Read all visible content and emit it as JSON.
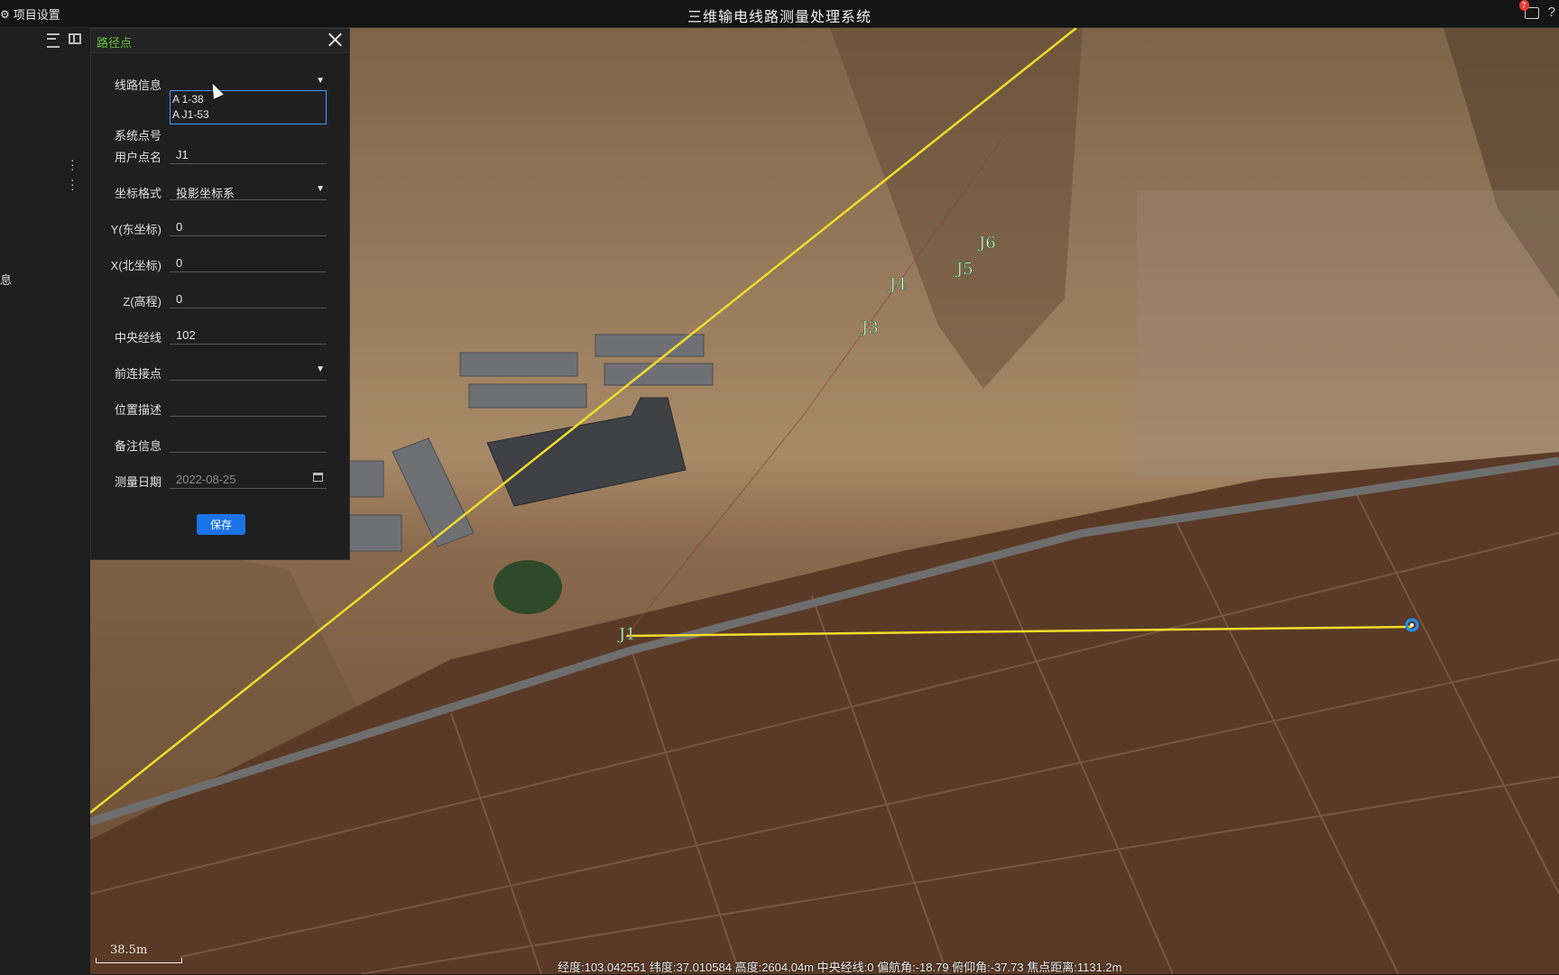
{
  "titlebar": {
    "project_settings": "项目设置",
    "app_title": "三维输电线路测量处理系统",
    "notification_count": "7",
    "help": "?"
  },
  "sidebar": {
    "info_label": "息"
  },
  "dialog": {
    "title": "路径点",
    "fields": {
      "line_info": {
        "label": "线路信息",
        "value": ""
      },
      "system_point": {
        "label": "系统点号",
        "options": [
          "A 1-38",
          "A J1-53"
        ]
      },
      "user_point_name": {
        "label": "用户点名",
        "value": "J1"
      },
      "coord_format": {
        "label": "坐标格式",
        "value": "投影坐标系"
      },
      "y_east": {
        "label": "Y(东坐标)",
        "value": "0"
      },
      "x_north": {
        "label": "X(北坐标)",
        "value": "0"
      },
      "z_elev": {
        "label": "Z(高程)",
        "value": "0"
      },
      "central_meridian": {
        "label": "中央经线",
        "value": "102"
      },
      "prev_point": {
        "label": "前连接点",
        "value": ""
      },
      "location_desc": {
        "label": "位置描述",
        "value": ""
      },
      "remarks": {
        "label": "备注信息",
        "value": ""
      },
      "survey_date": {
        "label": "测量日期",
        "value": "2022-08-25"
      }
    },
    "save_label": "保存"
  },
  "map": {
    "markers": [
      "J1",
      "J3",
      "J4",
      "J5",
      "J6"
    ],
    "scale_label": "38.5m",
    "line_color": "#f0dc2c",
    "status": "经度:103.042551 纬度:37.010584 高度:2604.04m 中央经线:0 偏航角:-18.79 俯仰角:-37.73 焦点距离:1131.2m"
  }
}
